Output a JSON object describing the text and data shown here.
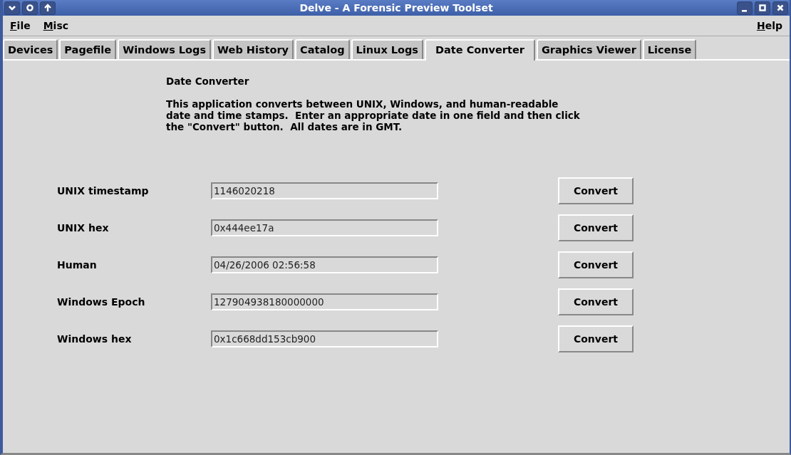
{
  "window": {
    "title": "Delve - A Forensic Preview Toolset"
  },
  "menu": [
    {
      "label": "File"
    },
    {
      "label": "Misc"
    },
    {
      "label": "Help"
    }
  ],
  "tabs": [
    {
      "label": "Devices",
      "selected": false
    },
    {
      "label": "Pagefile",
      "selected": false
    },
    {
      "label": "Windows Logs",
      "selected": false
    },
    {
      "label": "Web History",
      "selected": false
    },
    {
      "label": "Catalog",
      "selected": false
    },
    {
      "label": "Linux Logs",
      "selected": false
    },
    {
      "label": "Date Converter",
      "selected": true
    },
    {
      "label": "Graphics Viewer",
      "selected": false
    },
    {
      "label": "License",
      "selected": false
    }
  ],
  "panel": {
    "heading": "Date Converter",
    "description": [
      "This application converts between UNIX, Windows, and human-readable",
      "date and time stamps.  Enter an appropriate date in one field and then click",
      "the \"Convert\" button.  All dates are in GMT."
    ]
  },
  "rows": [
    {
      "label": "UNIX timestamp",
      "value": "1146020218",
      "button": "Convert"
    },
    {
      "label": "UNIX hex",
      "value": "0x444ee17a",
      "button": "Convert"
    },
    {
      "label": "Human",
      "value": "04/26/2006 02:56:58",
      "button": "Convert"
    },
    {
      "label": "Windows Epoch",
      "value": "127904938180000000",
      "button": "Convert"
    },
    {
      "label": "Windows hex",
      "value": "0x1c668dd153cb900",
      "button": "Convert"
    }
  ]
}
